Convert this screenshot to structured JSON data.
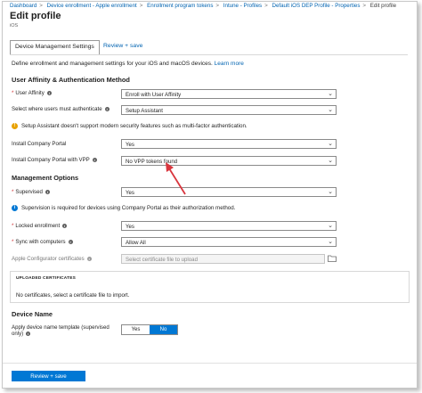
{
  "breadcrumb": [
    "Dashboard",
    "Device enrollment - Apple enrollment",
    "Enrollment program tokens",
    "Intune - Profiles",
    "Default iOS DEP Profile - Properties",
    "Edit profile"
  ],
  "header": {
    "title": "Edit profile",
    "subtitle": "iOS"
  },
  "tabs": {
    "active": "Device Management Settings",
    "next": "Review + save"
  },
  "description": {
    "text": "Define enrollment and management settings for your iOS and macOS devices.",
    "link": "Learn more"
  },
  "sections": {
    "affinity": "User Affinity & Authentication Method",
    "management": "Management Options",
    "device_name": "Device Name"
  },
  "fields": {
    "user_affinity": {
      "label": "User Affinity",
      "value": "Enroll with User Affinity"
    },
    "auth_method": {
      "label": "Select where users must authenticate",
      "value": "Setup Assistant"
    },
    "warning": "Setup Assistant doesn't support modern security features such as multi-factor authentication.",
    "install_cp": {
      "label": "Install Company Portal",
      "value": "Yes"
    },
    "install_cp_vpp": {
      "label": "Install Company Portal with VPP",
      "value": "No VPP tokens found"
    },
    "supervised": {
      "label": "Supervised",
      "value": "Yes"
    },
    "supervision_note": "Supervision is required for devices using Company Portal as their authorization method.",
    "locked": {
      "label": "Locked enrollment",
      "value": "Yes"
    },
    "sync": {
      "label": "Sync with computers",
      "value": "Allow All"
    },
    "configurator": {
      "label": "Apple Configurator certificates",
      "placeholder": "Select certificate file to upload"
    },
    "name_template": {
      "label_line1": "Apply device name template (supervised",
      "label_line2": "only)",
      "yes": "Yes",
      "no": "No",
      "selected": "No"
    }
  },
  "certificates": {
    "header": "UPLOADED CERTIFICATES",
    "empty": "No certificates, select a certificate file to import."
  },
  "footer": {
    "review_button": "Review + save"
  },
  "colors": {
    "accent": "#0078d4",
    "link": "#0063b1",
    "arrow": "#d9363e",
    "warning": "#e8a200",
    "required": "#d13438"
  },
  "icons": [
    "info-icon",
    "warning-icon",
    "chevron-down-icon",
    "folder-icon"
  ]
}
